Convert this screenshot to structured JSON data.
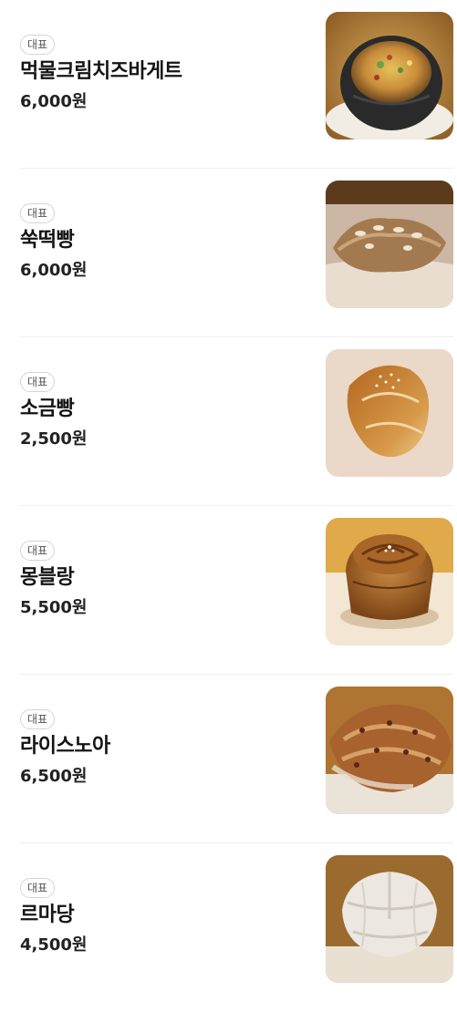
{
  "menu": {
    "items": [
      {
        "badge": "대표",
        "name": "먹물크림치즈바게트",
        "price": "6,000원",
        "image": "squid-ink-cream-cheese-baguette-photo"
      },
      {
        "badge": "대표",
        "name": "쑥떡빵",
        "price": "6,000원",
        "image": "mugwort-rice-cake-bread-photo"
      },
      {
        "badge": "대표",
        "name": "소금빵",
        "price": "2,500원",
        "image": "salt-bread-photo"
      },
      {
        "badge": "대표",
        "name": "몽블랑",
        "price": "5,500원",
        "image": "mont-blanc-pastry-photo"
      },
      {
        "badge": "대표",
        "name": "라이스노아",
        "price": "6,500원",
        "image": "rice-noix-bread-photo"
      },
      {
        "badge": "대표",
        "name": "르마당",
        "price": "4,500원",
        "image": "le-madang-bread-photo"
      }
    ]
  }
}
